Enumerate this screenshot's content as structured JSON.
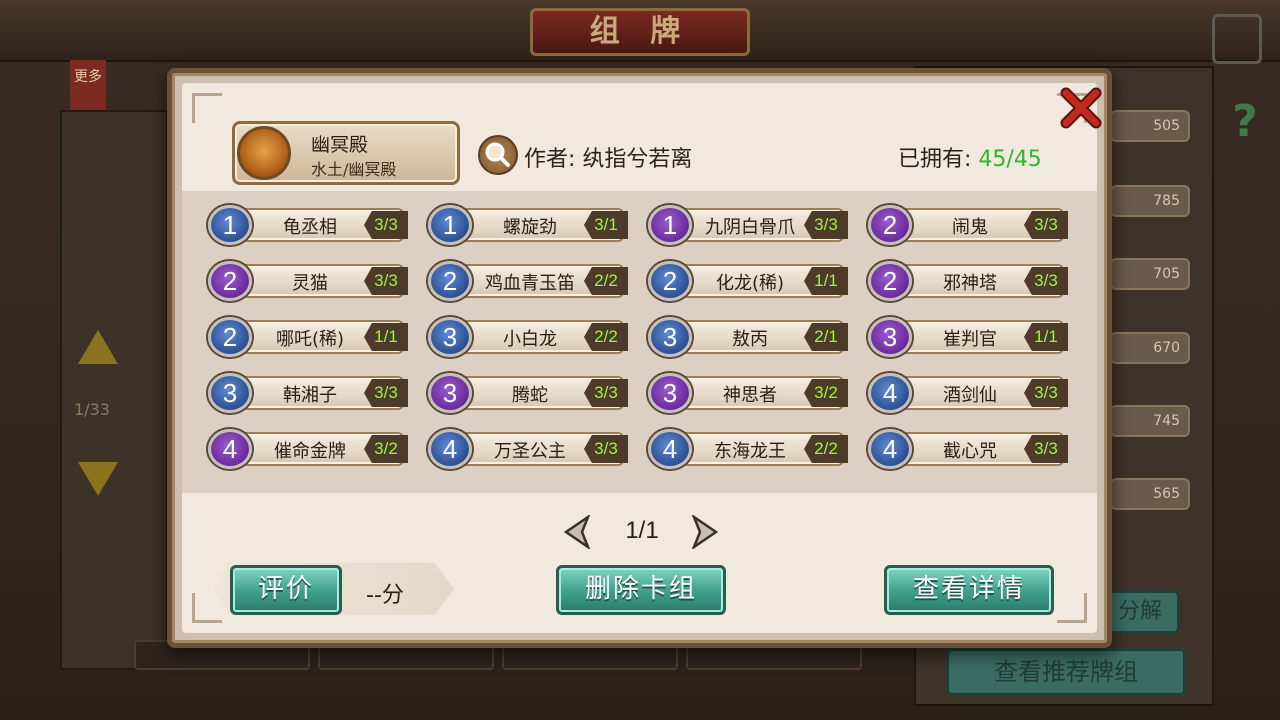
{
  "background": {
    "title": "组 牌",
    "more_label": "更多",
    "page_indicator": "1/33",
    "costs": [
      "505",
      "785",
      "705",
      "670",
      "745",
      "565"
    ],
    "recommend_label": "查看推荐牌组",
    "decompose_label": "分解"
  },
  "modal": {
    "deck_name": "幽冥殿",
    "deck_subtitle": "水土/幽冥殿",
    "author_label": "作者: 纨指兮若离",
    "owned_label": "已拥有: ",
    "owned_value": "45/45",
    "cards": [
      {
        "cost": "1",
        "color": "blue",
        "name": "龟丞相",
        "count": "3/3"
      },
      {
        "cost": "1",
        "color": "blue",
        "name": "螺旋劲",
        "count": "3/1"
      },
      {
        "cost": "1",
        "color": "purple",
        "name": "九阴白骨爪",
        "count": "3/3"
      },
      {
        "cost": "2",
        "color": "purple",
        "name": "闹鬼",
        "count": "3/3"
      },
      {
        "cost": "2",
        "color": "purple",
        "name": "灵猫",
        "count": "3/3"
      },
      {
        "cost": "2",
        "color": "blue",
        "name": "鸡血青玉笛",
        "count": "2/2"
      },
      {
        "cost": "2",
        "color": "blue",
        "name": "化龙(稀)",
        "count": "1/1"
      },
      {
        "cost": "2",
        "color": "purple",
        "name": "邪神塔",
        "count": "3/3"
      },
      {
        "cost": "2",
        "color": "blue",
        "name": "哪吒(稀)",
        "count": "1/1"
      },
      {
        "cost": "3",
        "color": "blue",
        "name": "小白龙",
        "count": "2/2"
      },
      {
        "cost": "3",
        "color": "blue",
        "name": "敖丙",
        "count": "2/1"
      },
      {
        "cost": "3",
        "color": "purple",
        "name": "崔判官",
        "count": "1/1"
      },
      {
        "cost": "3",
        "color": "blue",
        "name": "韩湘子",
        "count": "3/3"
      },
      {
        "cost": "3",
        "color": "purple",
        "name": "腾蛇",
        "count": "3/3"
      },
      {
        "cost": "3",
        "color": "purple",
        "name": "神思者",
        "count": "3/2"
      },
      {
        "cost": "4",
        "color": "blue",
        "name": "酒剑仙",
        "count": "3/3"
      },
      {
        "cost": "4",
        "color": "purple",
        "name": "催命金牌",
        "count": "3/2"
      },
      {
        "cost": "4",
        "color": "blue",
        "name": "万圣公主",
        "count": "3/3"
      },
      {
        "cost": "4",
        "color": "blue",
        "name": "东海龙王",
        "count": "2/2"
      },
      {
        "cost": "4",
        "color": "blue",
        "name": "截心咒",
        "count": "3/3"
      }
    ],
    "pagination": "1/1",
    "rate_label": "评价",
    "rating_value": "--分",
    "delete_label": "删除卡组",
    "detail_label": "查看详情"
  },
  "colors": {
    "owned_value": "#2fb52f",
    "count_text": "#9ef24a",
    "cost_blue": "#2d4f92",
    "cost_purple": "#6a2a9c",
    "button_teal": "#3e9e89",
    "close_red": "#b3241c"
  },
  "icons": {
    "close": "close-icon",
    "search": "search-icon",
    "prev": "chevron-left-icon",
    "next": "chevron-right-icon",
    "help": "question-icon",
    "back": "back-icon"
  }
}
